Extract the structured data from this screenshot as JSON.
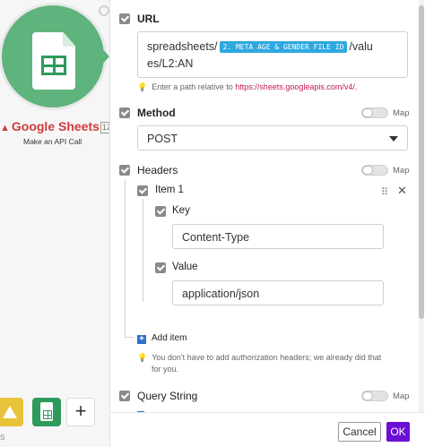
{
  "module": {
    "title": "Google Sheets",
    "subtitle": "Make an API Call",
    "badge": "12",
    "icon": "google-sheets-icon",
    "color": "#5fb37c"
  },
  "dock": {
    "items": [
      "google-drive-icon",
      "google-sheets-icon",
      "plus-icon"
    ],
    "add_label": "+",
    "bottom_label": "S"
  },
  "url": {
    "label": "URL",
    "prefix": "spreadsheets/",
    "pill": "2. META AGE & GENDER FILE ID",
    "suffix_line1": "/valu",
    "line2": "es/L2:AN",
    "hint_text": "Enter a path relative to",
    "hint_link": "https://sheets.googleapis.com/v4/."
  },
  "method": {
    "label": "Method",
    "map_label": "Map",
    "value": "POST"
  },
  "headers": {
    "label": "Headers",
    "map_label": "Map",
    "item_label": "Item 1",
    "key_label": "Key",
    "key_value": "Content-Type",
    "value_label": "Value",
    "value_value": "application/json",
    "add_item": "Add item",
    "hint_line1": "You don't have to add authorization headers; we already did that",
    "hint_line2": "for you."
  },
  "query": {
    "label": "Query String",
    "map_label": "Map"
  },
  "footer": {
    "cancel": "Cancel",
    "ok": "OK"
  },
  "colors": {
    "primary": "#6b0fd6",
    "link": "#c2185b",
    "pill": "#2fa8e0",
    "error": "#d23b3b"
  }
}
